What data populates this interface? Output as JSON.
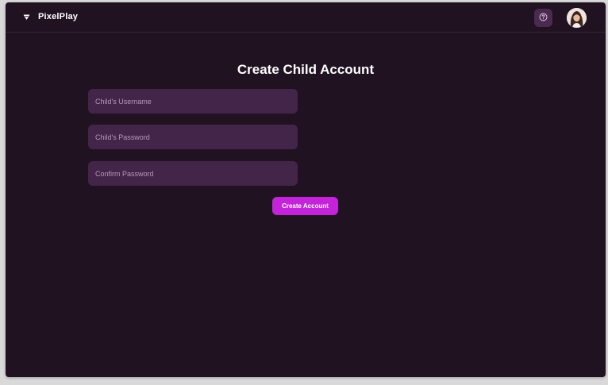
{
  "app": {
    "name": "PixelPlay",
    "logo_icon": "triangle-down-logo-icon"
  },
  "header": {
    "help_icon": "question-circle-icon",
    "avatar_icon": "user-avatar"
  },
  "form": {
    "title": "Create Child Account",
    "username_placeholder": "Child's Username",
    "password_placeholder": "Child's Password",
    "confirm_placeholder": "Confirm Password",
    "submit_label": "Create Account"
  },
  "colors": {
    "background": "#211221",
    "field": "#43254a",
    "accent": "#c324d9",
    "help_button": "#4a2a4f"
  }
}
